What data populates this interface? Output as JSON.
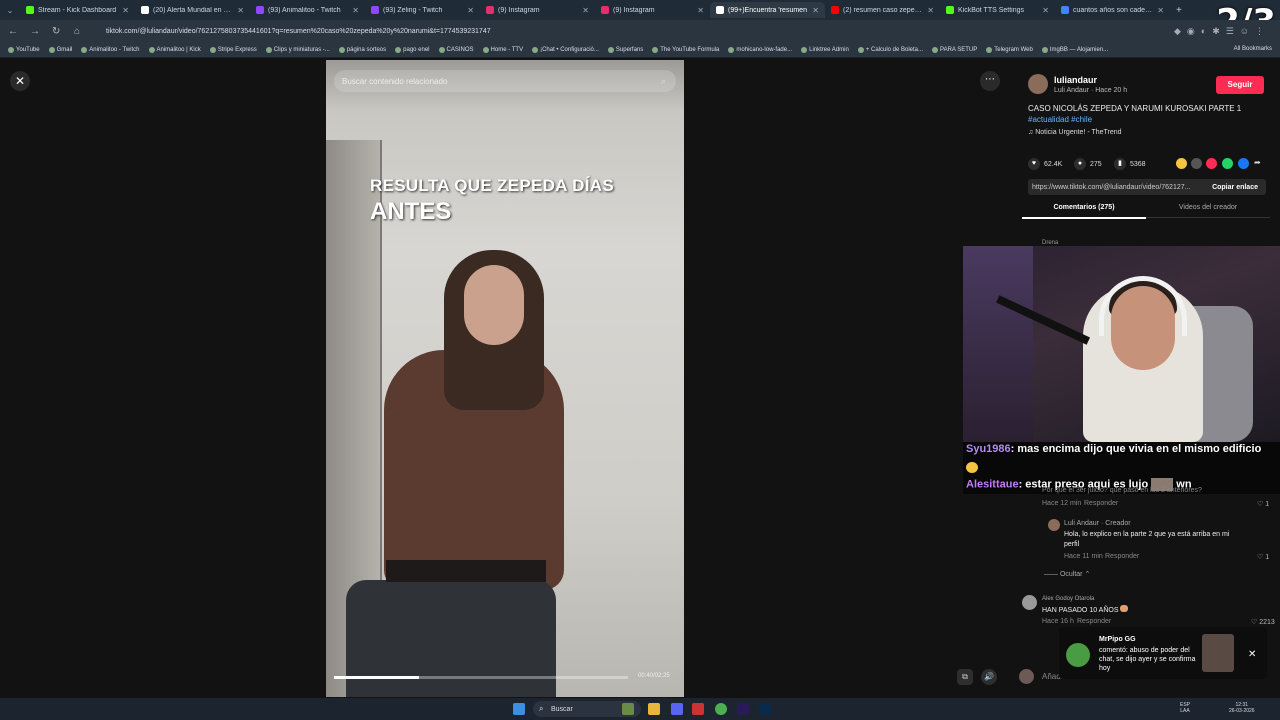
{
  "counter": "2/3",
  "tabs": [
    {
      "label": "Stream - Kick Dashboard",
      "color": "#53fc18"
    },
    {
      "label": "(20) Alerta Mundial en X: \"co",
      "color": "#ffffff"
    },
    {
      "label": "(93) Animalitoo - Twitch",
      "color": "#9146ff"
    },
    {
      "label": "(93) Zeling - Twitch",
      "color": "#9146ff"
    },
    {
      "label": "(9) Instagram",
      "color": "#e1306c"
    },
    {
      "label": "(9) Instagram",
      "color": "#e1306c"
    },
    {
      "label": "(99+)Encuentra 'resumen",
      "color": "#ffffff"
    },
    {
      "label": "(2) resumen caso zepeda y n",
      "color": "#ff0000"
    },
    {
      "label": "KickBot TTS Settings",
      "color": "#53fc18"
    },
    {
      "label": "cuantos años son cadena pe",
      "color": "#4285f4"
    }
  ],
  "address": {
    "url": "tiktok.com/@luliandaur/video/7621275803735441601?q=resumen%20caso%20zepeda%20y%20narumi&t=1774539231747"
  },
  "bookmarks": [
    "YouTube",
    "Gmail",
    "Animalitoo - Twitch",
    "Animalitoo | Kick",
    "Stripe Express",
    "Clips y miniaturas -...",
    "página sorteos",
    "pago enel",
    "CASINOS",
    "Home - TTV",
    "¡Chat • Configuració...",
    "Superfans",
    "The YouTube Formula",
    "mohicano-low-fade...",
    "Linktree Admin",
    "+ Calculo de Boleta...",
    "PARA SETUP",
    "Telegram Web",
    "ImgBB — Alojamien..."
  ],
  "all_bookmarks": "All Bookmarks",
  "video": {
    "search_placeholder": "Buscar contenido relacionado",
    "caption_line1": "RESULTA QUE ZEPEDA DÍAS",
    "caption_line2": "ANTES",
    "time": "00:40/02:25",
    "progress": 0.29
  },
  "creator": {
    "username": "luliandaur",
    "sub": "Luli Andaur · Hace 20 h",
    "follow": "Seguir",
    "desc": "CASO NICOLÁS ZEPEDA Y NARUMI KUROSAKI PARTE 1",
    "hashtags": "#actualidad #chile",
    "music": "♫  Noticia Urgente! - TheTrend"
  },
  "stats": {
    "likes": "62.4K",
    "comments": "275",
    "saves": "5368"
  },
  "link": {
    "url": "https://www.tiktok.com/@luliandaur/video/762127...",
    "copy": "Copiar enlace"
  },
  "panel_tabs": {
    "comments": "Comentarios (275)",
    "videos": "Videos del creador"
  },
  "first_commenter": "Drena",
  "chat": [
    {
      "user": "Syu1986",
      "text": ": mas encima dijo que vivia en el mismo edificio"
    },
    {
      "user": "Alesittaue",
      "text": ": estar preso aqui es lujo",
      "tail": "wn"
    }
  ],
  "comments": {
    "under_chat": "Por qué el 3er juicio? qué pasó en los 2 anteriores?",
    "c1_meta": "Hace 12 min",
    "reply": "Responder",
    "c1_likes": "1",
    "c2_author": "Luli Andaur · Creador",
    "c2_text": "Hola, lo explico en la parte 2 que ya está arriba en mi perfil",
    "c2_meta": "Hace 11 min",
    "c2_likes": "1",
    "hide": "Ocultar ⌃",
    "c3_author": "Alex Godoy Otarola",
    "c3_text": "HAN PASADO 10 AÑOS",
    "c3_meta": "Hace 16 h",
    "c3_likes": "2213",
    "add_placeholder": "Añadir comentario..."
  },
  "notification": {
    "name": "MrPipo GG",
    "text": "comentó: abuso de poder del chat, se dijo ayer y se confirma hoy"
  },
  "taskbar": {
    "search": "Buscar",
    "lang": "ESP\nLAA",
    "time": "12:31",
    "date": "26-03-2026"
  }
}
